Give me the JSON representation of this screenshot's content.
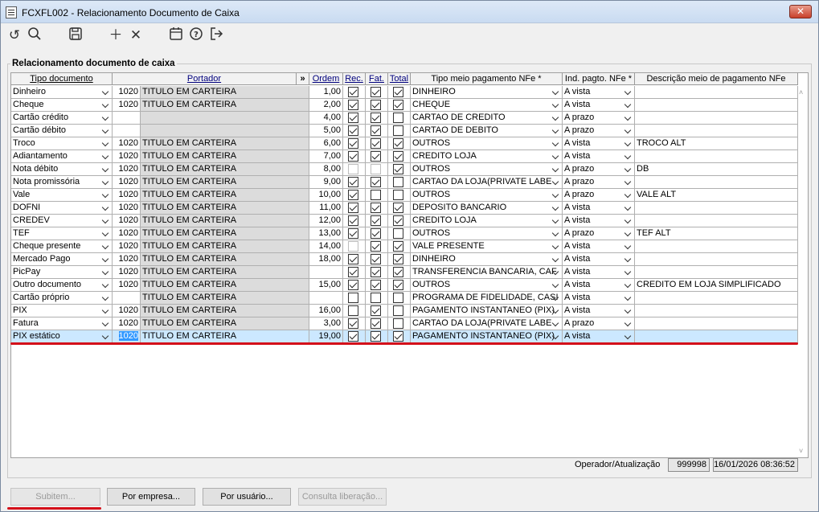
{
  "window": {
    "title": "FCXFL002 - Relacionamento Documento de Caixa",
    "close": "✕"
  },
  "group_title": "Relacionamento documento de caixa",
  "headers": {
    "tipo": "Tipo documento",
    "portador": "Portador",
    "expand": "»",
    "ordem": "Ordem",
    "rec": "Rec.",
    "fat": "Fat.",
    "total": "Total",
    "tipo_meio": "Tipo meio pagamento NFe *",
    "ind": "Ind. pagto. NFe *",
    "desc": "Descrição meio de pagamento NFe"
  },
  "rows": [
    {
      "tipo": "Dinheiro",
      "code": "1020",
      "portador": "TITULO EM CARTEIRA",
      "ordem": "1,00",
      "rec": true,
      "fat": true,
      "total": true,
      "meio": "DINHEIRO",
      "ind": "A vista",
      "desc": ""
    },
    {
      "tipo": "Cheque",
      "code": "1020",
      "portador": "TITULO EM CARTEIRA",
      "ordem": "2,00",
      "rec": true,
      "fat": true,
      "total": true,
      "meio": "CHEQUE",
      "ind": "A vista",
      "desc": ""
    },
    {
      "tipo": "Cartão crédito",
      "code": "",
      "portador": "",
      "ordem": "4,00",
      "rec": true,
      "fat": true,
      "total": false,
      "meio": "CARTAO DE CREDITO",
      "ind": "A prazo",
      "desc": ""
    },
    {
      "tipo": "Cartão débito",
      "code": "",
      "portador": "",
      "ordem": "5,00",
      "rec": true,
      "fat": true,
      "total": false,
      "meio": "CARTAO DE DEBITO",
      "ind": "A prazo",
      "desc": ""
    },
    {
      "tipo": "Troco",
      "code": "1020",
      "portador": "TITULO EM CARTEIRA",
      "ordem": "6,00",
      "rec": true,
      "fat": true,
      "total": true,
      "meio": "OUTROS",
      "ind": "A vista",
      "desc": "TROCO ALT"
    },
    {
      "tipo": "Adiantamento",
      "code": "1020",
      "portador": "TITULO EM CARTEIRA",
      "ordem": "7,00",
      "rec": true,
      "fat": true,
      "total": true,
      "meio": "CREDITO LOJA",
      "ind": "A vista",
      "desc": ""
    },
    {
      "tipo": "Nota débito",
      "code": "1020",
      "portador": "TITULO EM CARTEIRA",
      "ordem": "8,00",
      "rec": false,
      "fat": false,
      "total": true,
      "meio": "OUTROS",
      "ind": "A prazo",
      "desc": "DB",
      "rec_dis": true,
      "fat_dis": true
    },
    {
      "tipo": "Nota promissória",
      "code": "1020",
      "portador": "TITULO EM CARTEIRA",
      "ordem": "9,00",
      "rec": true,
      "fat": true,
      "total": false,
      "meio": "CARTAO DA LOJA(PRIVATE LABE",
      "ind": "A prazo",
      "desc": ""
    },
    {
      "tipo": "Vale",
      "code": "1020",
      "portador": "TITULO EM CARTEIRA",
      "ordem": "10,00",
      "rec": true,
      "fat": false,
      "total": false,
      "meio": "OUTROS",
      "ind": "A prazo",
      "desc": "VALE ALT"
    },
    {
      "tipo": "DOFNI",
      "code": "1020",
      "portador": "TITULO EM CARTEIRA",
      "ordem": "11,00",
      "rec": true,
      "fat": true,
      "total": true,
      "meio": "DEPOSITO BANCARIO",
      "ind": "A vista",
      "desc": ""
    },
    {
      "tipo": "CREDEV",
      "code": "1020",
      "portador": "TITULO EM CARTEIRA",
      "ordem": "12,00",
      "rec": true,
      "fat": true,
      "total": true,
      "meio": "CREDITO LOJA",
      "ind": "A vista",
      "desc": ""
    },
    {
      "tipo": "TEF",
      "code": "1020",
      "portador": "TITULO EM CARTEIRA",
      "ordem": "13,00",
      "rec": true,
      "fat": true,
      "total": false,
      "meio": "OUTROS",
      "ind": "A prazo",
      "desc": "TEF ALT"
    },
    {
      "tipo": "Cheque presente",
      "code": "1020",
      "portador": "TITULO EM CARTEIRA",
      "ordem": "14,00",
      "rec": false,
      "fat": true,
      "total": true,
      "meio": "VALE PRESENTE",
      "ind": "A vista",
      "desc": "",
      "rec_dis": true
    },
    {
      "tipo": "Mercado Pago",
      "code": "1020",
      "portador": "TITULO EM CARTEIRA",
      "ordem": "18,00",
      "rec": true,
      "fat": true,
      "total": true,
      "meio": "DINHEIRO",
      "ind": "A vista",
      "desc": ""
    },
    {
      "tipo": "PicPay",
      "code": "1020",
      "portador": "TITULO EM CARTEIRA",
      "ordem": "",
      "rec": true,
      "fat": true,
      "total": true,
      "meio": "TRANSFERENCIA BANCARIA, CAF",
      "ind": "A vista",
      "desc": ""
    },
    {
      "tipo": "Outro documento",
      "code": "1020",
      "portador": "TITULO EM CARTEIRA",
      "ordem": "15,00",
      "rec": true,
      "fat": true,
      "total": true,
      "meio": "OUTROS",
      "ind": "A vista",
      "desc": "CREDITO EM LOJA SIMPLIFICADO"
    },
    {
      "tipo": "Cartão próprio",
      "code": "",
      "portador": "TITULO EM CARTEIRA",
      "ordem": "",
      "rec": false,
      "fat": false,
      "total": false,
      "meio": "PROGRAMA DE FIDELIDADE, CASI",
      "ind": "A vista",
      "desc": ""
    },
    {
      "tipo": "PIX",
      "code": "1020",
      "portador": "TITULO EM CARTEIRA",
      "ordem": "16,00",
      "rec": false,
      "fat": true,
      "total": false,
      "meio": "PAGAMENTO INSTANTANEO (PIX)",
      "ind": "A vista",
      "desc": ""
    },
    {
      "tipo": "Fatura",
      "code": "1020",
      "portador": "TITULO EM CARTEIRA",
      "ordem": "3,00",
      "rec": true,
      "fat": true,
      "total": false,
      "meio": "CARTAO DA LOJA(PRIVATE LABE",
      "ind": "A prazo",
      "desc": ""
    },
    {
      "tipo": "PIX estático",
      "code": "1020",
      "portador": "TITULO EM CARTEIRA",
      "ordem": "19,00",
      "rec": true,
      "fat": true,
      "total": true,
      "meio": "PAGAMENTO INSTANTANEO (PIX)",
      "ind": "A vista",
      "desc": "",
      "selected": true
    }
  ],
  "footer": {
    "label": "Operador/Atualização",
    "operator": "999998",
    "datetime": "16/01/2026 08:36:52"
  },
  "buttons": {
    "subitem": "Subitem...",
    "por_empresa": "Por empresa...",
    "por_usuario": "Por usuário...",
    "consulta": "Consulta liberação..."
  },
  "colors": {
    "selection": "#cce8ff",
    "accent_red": "#d4101a",
    "link_blue": "#00007d"
  }
}
